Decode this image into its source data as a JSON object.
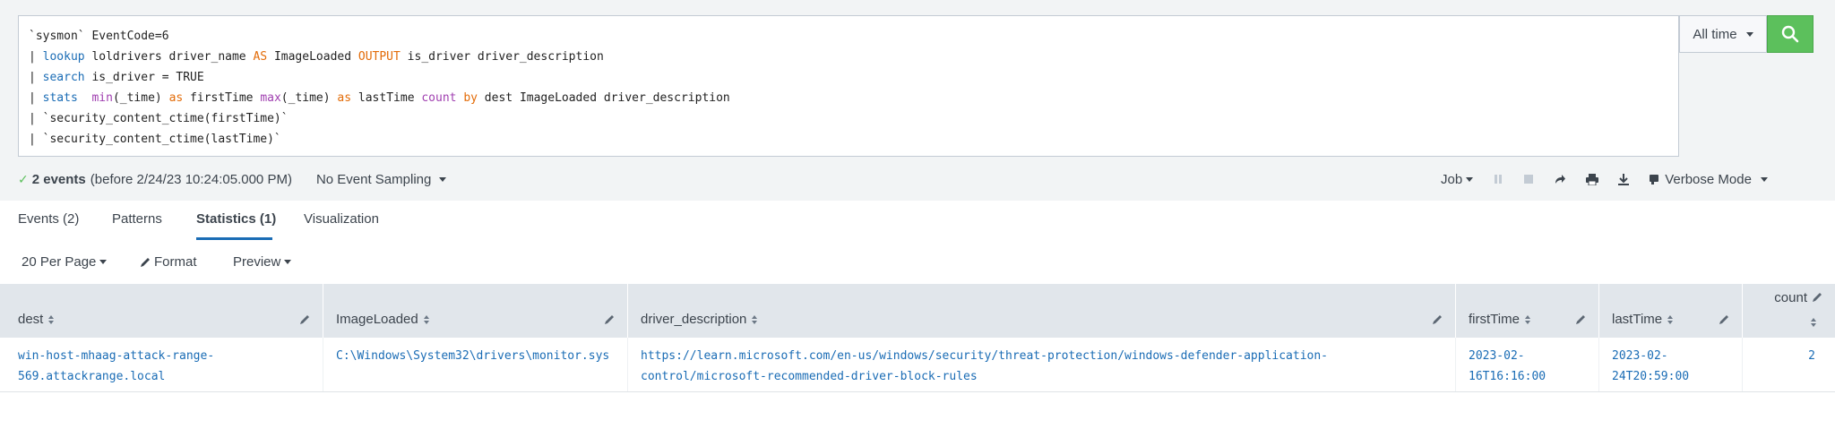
{
  "search": {
    "lines": [
      [
        {
          "t": "`sysmon` EventCode=6",
          "c": ""
        }
      ],
      [
        {
          "t": "| ",
          "c": ""
        },
        {
          "t": "lookup",
          "c": "blue"
        },
        {
          "t": " loldrivers driver_name ",
          "c": ""
        },
        {
          "t": "AS",
          "c": "orange"
        },
        {
          "t": " ImageLoaded ",
          "c": ""
        },
        {
          "t": "OUTPUT",
          "c": "orange"
        },
        {
          "t": " is_driver driver_description",
          "c": ""
        }
      ],
      [
        {
          "t": "| ",
          "c": ""
        },
        {
          "t": "search",
          "c": "blue"
        },
        {
          "t": " is_driver = TRUE",
          "c": ""
        }
      ],
      [
        {
          "t": "| ",
          "c": ""
        },
        {
          "t": "stats",
          "c": "blue"
        },
        {
          "t": "  ",
          "c": ""
        },
        {
          "t": "min",
          "c": "purple"
        },
        {
          "t": "(_time) ",
          "c": ""
        },
        {
          "t": "as",
          "c": "orange"
        },
        {
          "t": " firstTime ",
          "c": ""
        },
        {
          "t": "max",
          "c": "purple"
        },
        {
          "t": "(_time) ",
          "c": ""
        },
        {
          "t": "as",
          "c": "orange"
        },
        {
          "t": " lastTime ",
          "c": ""
        },
        {
          "t": "count",
          "c": "purple"
        },
        {
          "t": " ",
          "c": ""
        },
        {
          "t": "by",
          "c": "orange"
        },
        {
          "t": " dest ImageLoaded driver_description",
          "c": ""
        }
      ],
      [
        {
          "t": "| `security_content_ctime(firstTime)`",
          "c": ""
        }
      ],
      [
        {
          "t": "| `security_content_ctime(lastTime)`",
          "c": ""
        }
      ]
    ],
    "time_range": "All time",
    "search_icon": "magnifier-icon"
  },
  "status": {
    "events_count": "2 events",
    "events_detail": "(before 2/24/23 10:24:05.000 PM)",
    "sampling": "No Event Sampling"
  },
  "job": {
    "label": "Job",
    "mode": "Verbose Mode"
  },
  "tabs": [
    {
      "label": "Events (2)"
    },
    {
      "label": "Patterns"
    },
    {
      "label": "Statistics (1)"
    },
    {
      "label": "Visualization"
    }
  ],
  "toolbar": {
    "per_page": "20 Per Page",
    "format": "Format",
    "preview": "Preview"
  },
  "table": {
    "columns": [
      "dest",
      "ImageLoaded",
      "driver_description",
      "firstTime",
      "lastTime",
      "count"
    ],
    "rows": [
      {
        "dest_1": "win-host-mhaag-attack-range-",
        "dest_2": "569.attackrange.local",
        "image": "C:\\Windows\\System32\\drivers\\monitor.sys",
        "desc_1": "https://learn.microsoft.com/en-us/windows/security/threat-protection/windows-defender-application-",
        "desc_2": "control/microsoft-recommended-driver-block-rules",
        "first_1": "2023-02-",
        "first_2": "16T16:16:00",
        "last_1": "2023-02-",
        "last_2": "24T20:59:00",
        "count": "2"
      }
    ]
  },
  "colors": {
    "accent": "#1a6cb5",
    "search_button": "#5cc05c",
    "header_bg": "#e1e6eb"
  }
}
